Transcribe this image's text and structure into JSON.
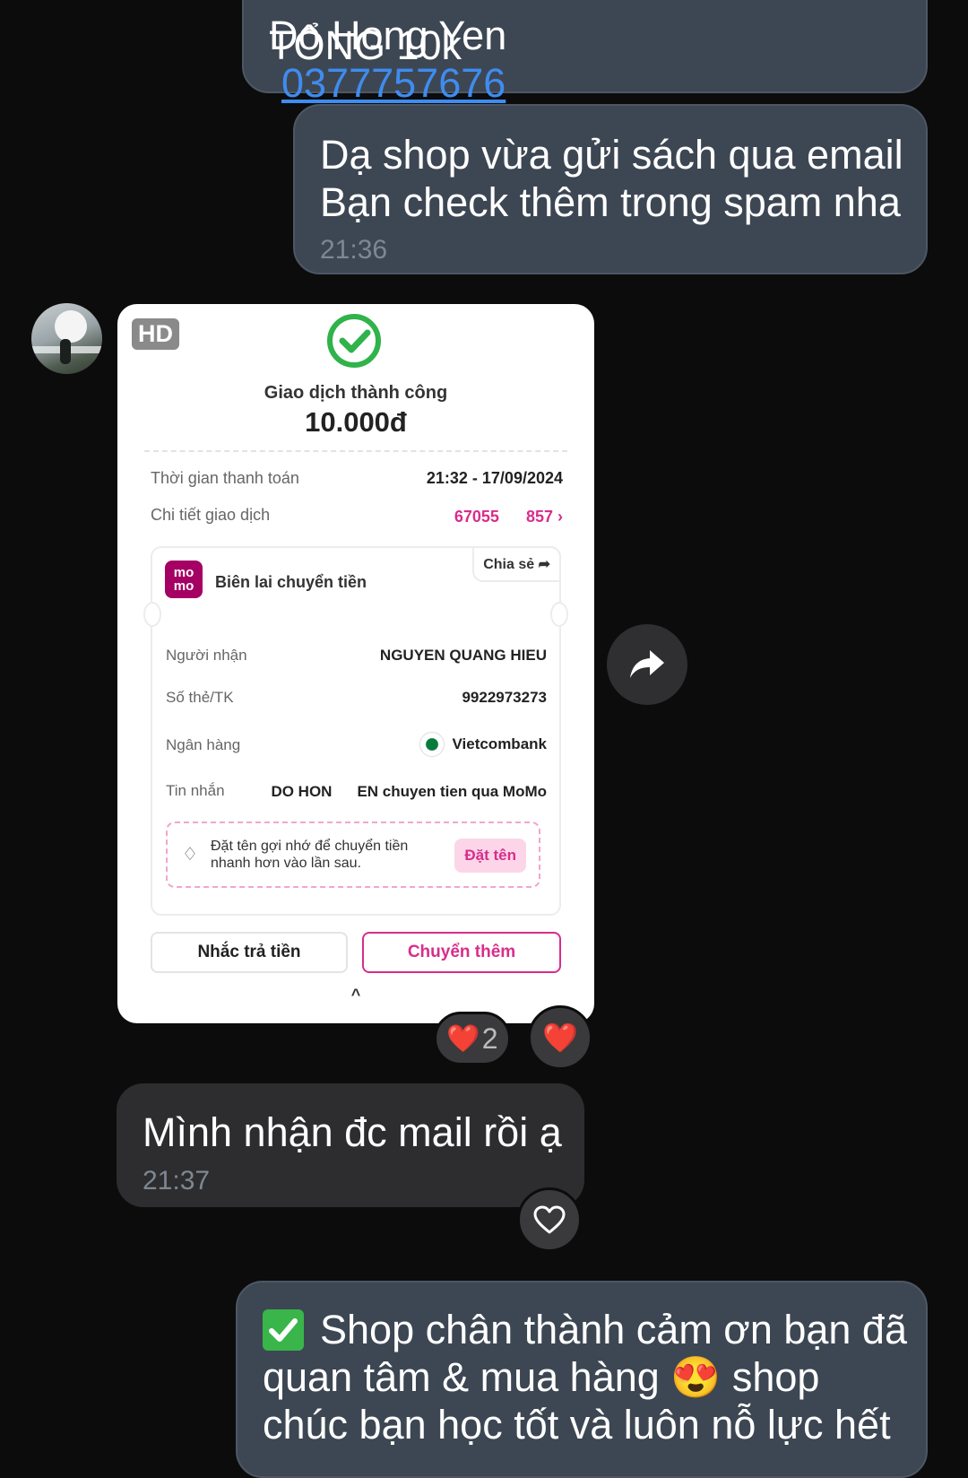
{
  "messages": {
    "m1": {
      "partial_name": "Do Hong Yen",
      "partial_phone": "0377757676",
      "total": "TỔNG 10k"
    },
    "m2": {
      "text": "Dạ shop vừa gửi sách qua email\nBạn check thêm trong spam nha",
      "time": "21:36"
    },
    "m4": {
      "text": "Mình nhận đc mail rồi ạ",
      "time": "21:37"
    },
    "m5": {
      "text": "Shop chân thành cảm ơn bạn đã\nquan tâm & mua hàng 😍 shop\nchúc bạn học tốt và luôn nỗ lực hết"
    }
  },
  "image_message": {
    "badge": "HD",
    "receipt": {
      "status": "Giao dịch thành công",
      "amount": "10.000đ",
      "time_label": "Thời gian thanh toán",
      "time_value": "21:32 - 17/09/2024",
      "detail_label": "Chi tiết giao dịch",
      "detail_value": "67055‧‧‧857",
      "detail_part1": "67055",
      "detail_part2": "857",
      "brand": "mo mo",
      "card_title": "Biên lai chuyển tiền",
      "share_label": "Chia sẻ",
      "recipient_label": "Người nhận",
      "recipient_value": "NGUYEN QUANG HIEU",
      "account_label": "Số thẻ/TK",
      "account_value": "9922973273",
      "bank_label": "Ngân hàng",
      "bank_value": "Vietcombank",
      "message_label": "Tin nhắn",
      "message_value_1": "DO HON",
      "message_value_2": "EN chuyen tien qua MoMo",
      "tip_text": "Đặt tên gợi nhớ để chuyển tiền\nnhanh hơn vào lần sau.",
      "tip_button": "Đặt tên",
      "remind_button": "Nhắc trả tiền",
      "transfer_button": "Chuyển thêm",
      "collapse": "^"
    },
    "reactions": {
      "count_emoji": "❤️",
      "count": "2",
      "mine": "❤️"
    }
  },
  "icons": {
    "forward": "forward-arrow-icon",
    "heart_outline": "heart-outline-icon",
    "check_emoji": "✅"
  },
  "colors": {
    "background": "#0c0c0d",
    "outgoing": "#3d4753",
    "incoming": "#2d2d2f",
    "momo_pink": "#d82d8b",
    "success_green": "#2fb34a",
    "link": "#3f8cf0"
  }
}
